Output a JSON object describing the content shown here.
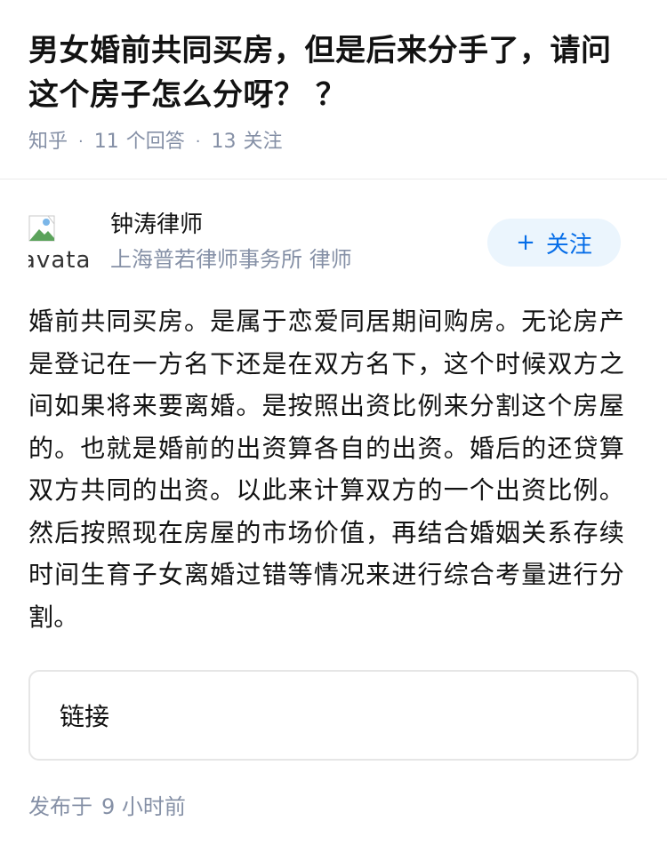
{
  "question": {
    "title": "男女婚前共同买房，但是后来分手了，请问这个房子怎么分呀？ ？",
    "source": "知乎",
    "answer_count": "11",
    "answer_label": "个回答",
    "follower_count": "13",
    "follower_label": "关注"
  },
  "author": {
    "avatar_alt": "avatar",
    "name": "钟涛律师",
    "description": "上海普若律师事务所 律师",
    "follow_label": "关注",
    "follow_icon": "plus-icon"
  },
  "answer": {
    "content": "婚前共同买房。是属于恋爱同居期间购房。无论房产是登记在一方名下还是在双方名下，这个时候双方之间如果将来要离婚。是按照出资比例来分割这个房屋的。也就是婚前的出资算各自的出资。婚后的还贷算双方共同的出资。以此来计算双方的一个出资比例。然后按照现在房屋的市场价值，再结合婚姻关系存续时间生育子女离婚过错等情况来进行综合考量进行分割。"
  },
  "link_card": {
    "label": "链接"
  },
  "publish": {
    "prefix": "发布于",
    "time": "9 小时前"
  },
  "colors": {
    "accent": "#056de8",
    "follow_bg": "#ebf5fd",
    "meta_text": "#8590a6",
    "main_text": "#121212"
  }
}
